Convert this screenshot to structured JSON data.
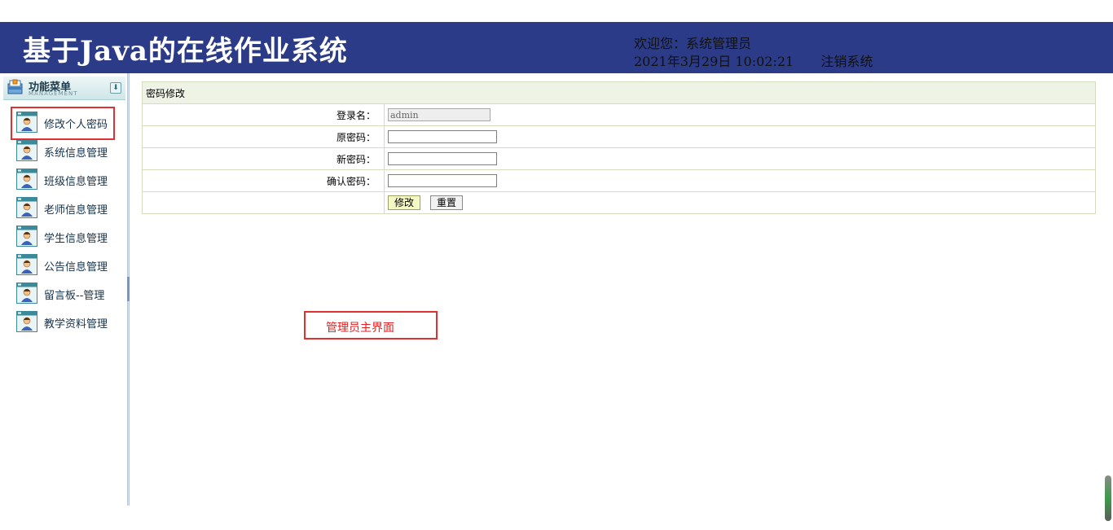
{
  "header": {
    "title": "基于Java的在线作业系统",
    "welcome": "欢迎您：系统管理员",
    "datetime": "2021年3月29日 10:02:21",
    "logout": "注销系统",
    "bg_color": "#2b3b87"
  },
  "sidebar": {
    "title": "功能菜单",
    "subtitle": "MANAGEMENT",
    "collapse_icon": "double-chevron-down-icon",
    "items": [
      {
        "label": "修改个人密码",
        "icon": "user-form-icon"
      },
      {
        "label": "系统信息管理",
        "icon": "user-form-icon"
      },
      {
        "label": "班级信息管理",
        "icon": "user-form-icon"
      },
      {
        "label": "老师信息管理",
        "icon": "user-form-icon"
      },
      {
        "label": "学生信息管理",
        "icon": "user-form-icon"
      },
      {
        "label": "公告信息管理",
        "icon": "user-form-icon"
      },
      {
        "label": "留言板--管理",
        "icon": "user-form-icon"
      },
      {
        "label": "教学资料管理",
        "icon": "user-form-icon"
      }
    ]
  },
  "form": {
    "title": "密码修改",
    "login_label": "登录名：",
    "login_value": "admin",
    "old_label": "原密码：",
    "new_label": "新密码：",
    "confirm_label": "确认密码：",
    "submit_label": "修改",
    "reset_label": "重置"
  },
  "annotation": {
    "text": "管理员主界面",
    "color": "#e02020"
  }
}
